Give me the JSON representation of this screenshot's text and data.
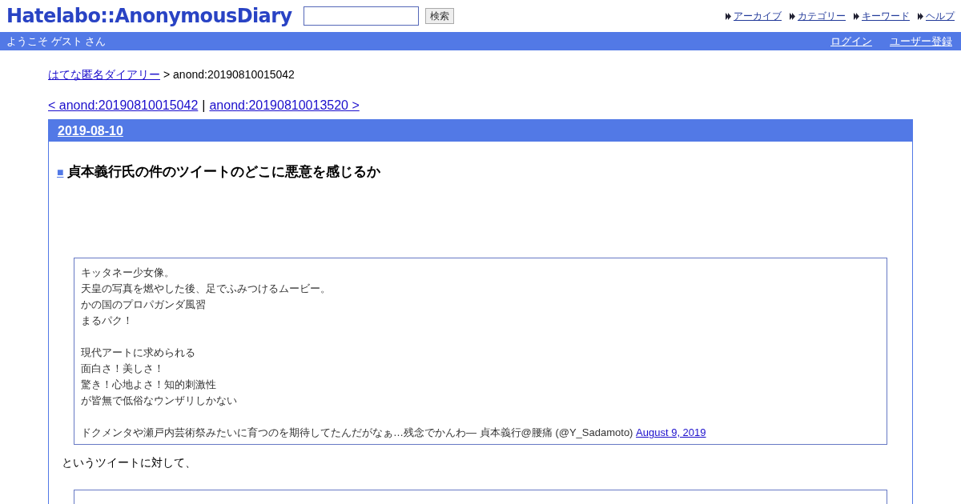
{
  "header": {
    "logo": "Hatelabo::AnonymousDiary",
    "search": {
      "button": "検索"
    },
    "nav_links": [
      "アーカイブ",
      "カテゴリー",
      "キーワード",
      "ヘルプ"
    ]
  },
  "user_bar": {
    "greeting": "ようこそ ゲスト さん",
    "links": [
      "ログイン",
      "ユーザー登録"
    ]
  },
  "breadcrumb": {
    "link": "はてな匿名ダイアリー",
    "current": "> anond:20190810015042"
  },
  "pager": {
    "prev": "< anond:20190810015042",
    "separator": "|",
    "next": "anond:20190810013520 >"
  },
  "day": {
    "date": "2019-08-10",
    "entry": {
      "marker": "■",
      "title": "貞本義行氏の件のツイートのどこに悪意を感じるか",
      "quote_stanzas": [
        [
          "キッタネー少女像。",
          "天皇の写真を燃やした後、足でふみつけるムービー。",
          "かの国のプロパガンダ風習",
          "まるパク！"
        ],
        [
          "現代アートに求められる",
          "面白さ！美しさ！",
          "驚き！心地よさ！知的刺激性",
          "が皆無で低俗なウンザリしかない"
        ]
      ],
      "quote_source": {
        "text": "ドクメンタや瀬戸内芸術祭みたいに育つのを期待してたんだがなぁ…残念でかんわ— 貞本義行@腰痛 (@Y_Sadamoto)",
        "date_link": "August 9, 2019"
      },
      "paragraph": "というツイートに対して、"
    }
  }
}
